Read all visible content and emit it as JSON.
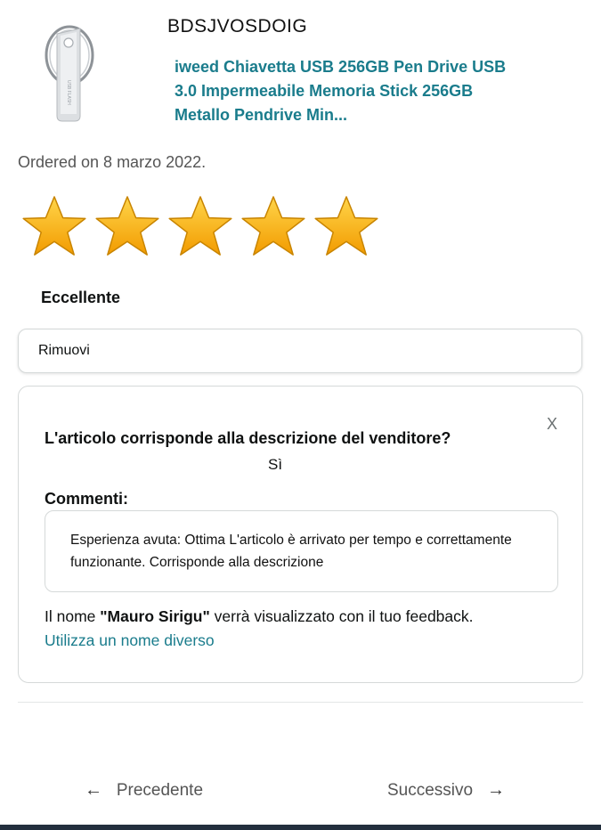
{
  "seller": {
    "name": "BDSJVOSDOIG"
  },
  "product": {
    "title": "iweed Chiavetta USB 256GB Pen Drive USB 3.0 Impermeabile Memoria Stick 256GB Metallo Pendrive Min...",
    "image_icon": "usb-drive-icon",
    "image_text": "USB FLASH"
  },
  "order": {
    "date_text": "Ordered on 8 marzo 2022."
  },
  "rating": {
    "value": 5,
    "max": 5,
    "label": "Eccellente",
    "star_color": "#ffb400"
  },
  "actions": {
    "remove_label": "Rimuovi"
  },
  "feedback": {
    "close_label": "X",
    "question": "L'articolo corrisponde alla descrizione del venditore?",
    "answer": "Sì",
    "comments_label": "Commenti:",
    "comments_text": "Esperienza avuta: Ottima L'articolo è arrivato per tempo e correttamente funzionante. Corrisponde alla descrizione",
    "name_prefix": "Il nome ",
    "display_name": "\"Mauro Sirigu\"",
    "name_suffix": " verrà visualizzato con il tuo feedback.",
    "change_name_label": "Utilizza un nome diverso"
  },
  "navigation": {
    "prev_arrow": "←",
    "prev_label": "Precedente",
    "next_label": "Successivo",
    "next_arrow": "→"
  },
  "colors": {
    "link": "#1a7c8c",
    "bottom_bar": "#232f3e"
  }
}
